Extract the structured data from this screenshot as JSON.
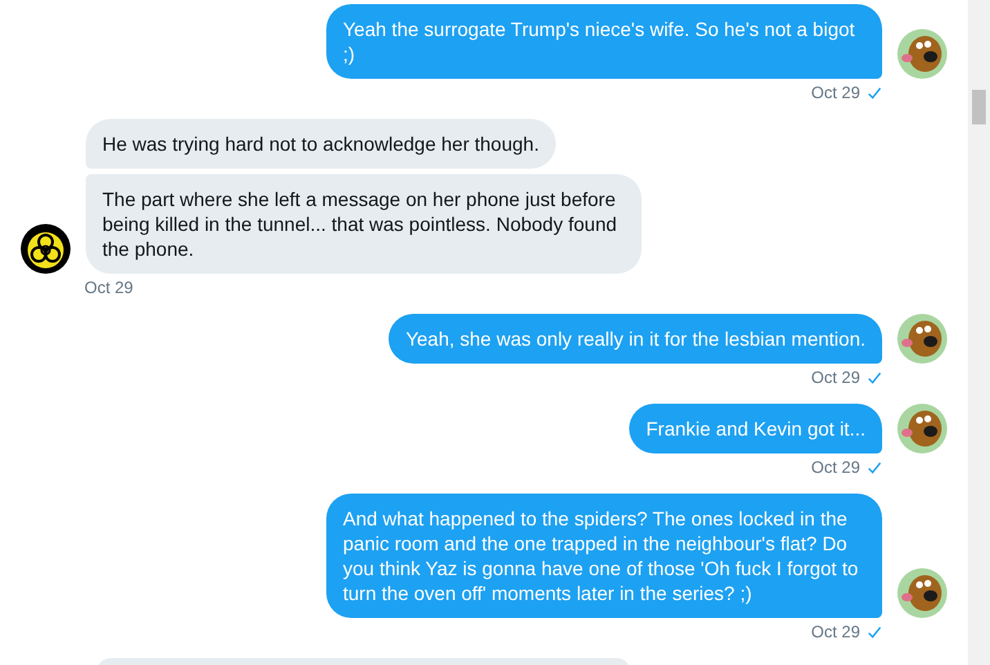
{
  "messages": [
    {
      "kind": "sent",
      "bubbles": [
        "Yeah the surrogate Trump's niece's wife. So he's not a bigot ;)"
      ],
      "time": "Oct 29",
      "read": true
    },
    {
      "kind": "received",
      "bubbles": [
        "He was trying hard not to acknowledge her though.",
        "The part where she left a message on her phone just before being killed in the tunnel...  that was pointless. Nobody found the phone."
      ],
      "time": "Oct 29"
    },
    {
      "kind": "sent",
      "bubbles": [
        "Yeah, she was only really in it for the lesbian mention."
      ],
      "time": "Oct 29",
      "read": true
    },
    {
      "kind": "sent",
      "bubbles": [
        "Frankie and Kevin got it..."
      ],
      "time": "Oct 29",
      "read": true
    },
    {
      "kind": "sent",
      "bubbles": [
        "And what happened to the spiders? The ones locked in the panic room and the one trapped in the neighbour's flat? Do you think Yaz is gonna have one of those 'Oh fuck I forgot to turn the oven off' moments later in the series? ;)"
      ],
      "time": "Oct 29",
      "read": true
    }
  ]
}
